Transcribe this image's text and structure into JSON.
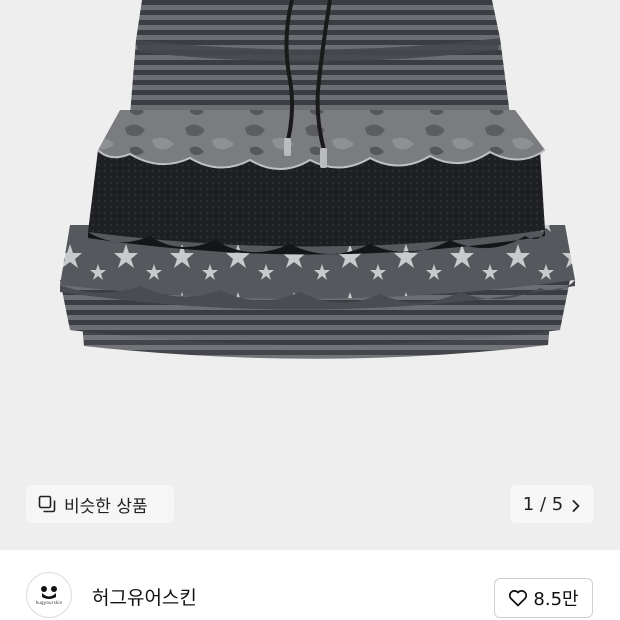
{
  "product_image": {
    "alt": "skirt-photo"
  },
  "similar_products": {
    "label": "비슷한 상품",
    "icon": "copy-icon"
  },
  "pager": {
    "text": "1 / 5",
    "icon": "chevron-right-icon"
  },
  "shop": {
    "name": "허그유어스킨",
    "logo_text": "hugyourskin"
  },
  "like": {
    "count": "8.5만",
    "icon": "heart-outline-icon"
  },
  "colors": {
    "photo_bg": "#eeeeee",
    "chip_bg": "#f6f6f6",
    "stripe_dark": "#3a3d42",
    "stripe_light": "#6b6e73"
  }
}
